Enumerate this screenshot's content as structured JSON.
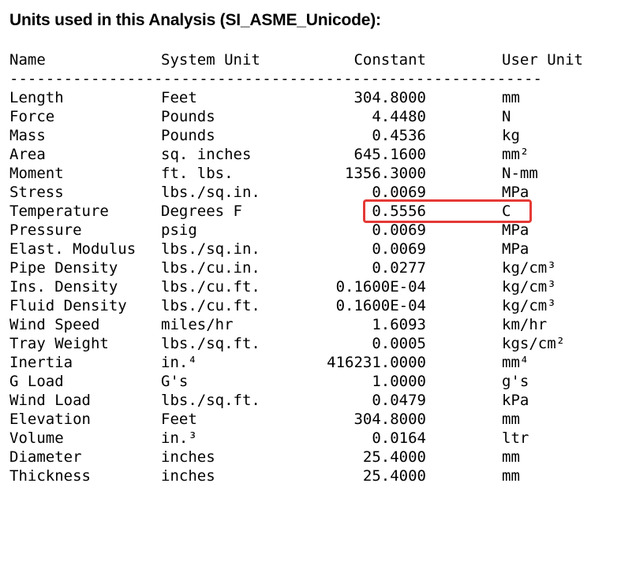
{
  "title": "Units used in this Analysis (SI_ASME_Unicode):",
  "headers": {
    "name": "Name",
    "system_unit": "System Unit",
    "constant": "Constant",
    "user_unit": "User Unit"
  },
  "rule": "-----------------------------------------------------------",
  "rows": [
    {
      "name": "Length",
      "system_unit": "Feet",
      "constant": "304.8000",
      "user_unit": "mm"
    },
    {
      "name": "Force",
      "system_unit": "Pounds",
      "constant": "4.4480",
      "user_unit": "N"
    },
    {
      "name": "Mass",
      "system_unit": "Pounds",
      "constant": "0.4536",
      "user_unit": "kg"
    },
    {
      "name": "Area",
      "system_unit": "sq. inches",
      "constant": "645.1600",
      "user_unit": "mm²"
    },
    {
      "name": "Moment",
      "system_unit": "ft. lbs.",
      "constant": "1356.3000",
      "user_unit": "N-mm"
    },
    {
      "name": "Stress",
      "system_unit": "lbs./sq.in.",
      "constant": "0.0069",
      "user_unit": "MPa"
    },
    {
      "name": "Temperature",
      "system_unit": "Degrees F",
      "constant": "0.5556",
      "user_unit": "C"
    },
    {
      "name": "Pressure",
      "system_unit": "psig",
      "constant": "0.0069",
      "user_unit": "MPa"
    },
    {
      "name": "Elast. Modulus",
      "system_unit": "lbs./sq.in.",
      "constant": "0.0069",
      "user_unit": "MPa"
    },
    {
      "name": "Pipe Density",
      "system_unit": "lbs./cu.in.",
      "constant": "0.0277",
      "user_unit": "kg/cm³"
    },
    {
      "name": "Ins. Density",
      "system_unit": "lbs./cu.ft.",
      "constant": "0.1600E-04",
      "user_unit": "kg/cm³"
    },
    {
      "name": "Fluid Density",
      "system_unit": "lbs./cu.ft.",
      "constant": "0.1600E-04",
      "user_unit": "kg/cm³"
    },
    {
      "name": "Wind Speed",
      "system_unit": "miles/hr",
      "constant": "1.6093",
      "user_unit": "km/hr"
    },
    {
      "name": "Tray Weight",
      "system_unit": "lbs./sq.ft.",
      "constant": "0.0005",
      "user_unit": "kgs/cm²"
    },
    {
      "name": "Inertia",
      "system_unit": "in.⁴",
      "constant": "416231.0000",
      "user_unit": "mm⁴"
    },
    {
      "name": "G Load",
      "system_unit": "G's",
      "constant": "1.0000",
      "user_unit": "g's"
    },
    {
      "name": "Wind Load",
      "system_unit": "lbs./sq.ft.",
      "constant": "0.0479",
      "user_unit": "kPa"
    },
    {
      "name": "Elevation",
      "system_unit": "Feet",
      "constant": "304.8000",
      "user_unit": "mm"
    },
    {
      "name": "Volume",
      "system_unit": "in.³",
      "constant": "0.0164",
      "user_unit": "ltr"
    },
    {
      "name": "Diameter",
      "system_unit": "inches",
      "constant": "25.4000",
      "user_unit": "mm"
    },
    {
      "name": "Thickness",
      "system_unit": "inches",
      "constant": "25.4000",
      "user_unit": "mm"
    }
  ],
  "highlight_color": "#e53935"
}
